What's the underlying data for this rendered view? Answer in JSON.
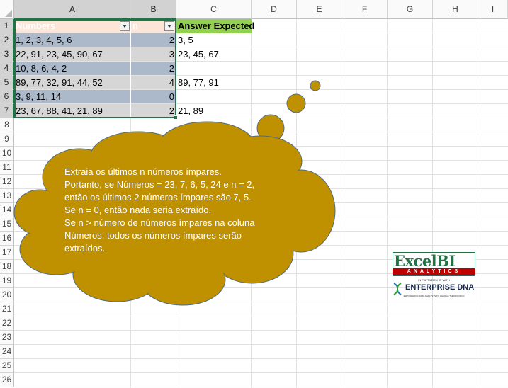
{
  "columns": [
    "A",
    "B",
    "C",
    "D",
    "E",
    "F",
    "G",
    "H",
    "I"
  ],
  "rows": [
    "1",
    "2",
    "3",
    "4",
    "5",
    "6",
    "7",
    "8",
    "9",
    "10",
    "11",
    "12",
    "13",
    "14",
    "15",
    "16",
    "17",
    "18",
    "19",
    "20",
    "21",
    "22",
    "23",
    "24",
    "25",
    "26"
  ],
  "table": {
    "header": {
      "numbers": "Numbers",
      "n": "n"
    },
    "numbers": [
      "1, 2, 3, 4, 5, 6",
      "22, 91, 23, 45, 90, 67",
      "10, 8, 6, 4, 2",
      "89, 77, 32, 91, 44, 52",
      "3, 9, 11, 14",
      "23, 67, 88, 41, 21, 89"
    ],
    "n": [
      "2",
      "3",
      "2",
      "4",
      "0",
      "2"
    ]
  },
  "answer": {
    "header": "Answer Expected",
    "values": [
      "3, 5",
      "23, 45, 67",
      "",
      "89, 77, 91",
      "",
      "21, 89"
    ]
  },
  "callout": {
    "lines": [
      "Extraia os últimos n números ímpares.",
      "Portanto, se Números = 23, 7, 6, 5, 24 e n = 2,",
      "então os últimos 2 números ímpares são 7, 5.",
      "Se n = 0, então nada seria extraído.",
      "Se n > número de números ímpares na coluna",
      "Números, todos os números ímpares serão",
      "extraídos."
    ],
    "fill_color": "#bf9000"
  },
  "logo": {
    "brand": "ExcelBI",
    "sub": "ANALYTICS",
    "partnership": "IN PARTNERSHIP WITH",
    "partner": "ENTERPRISE DNA",
    "tagline": "EMPOWERING DATA ANALYSTS TO CHANGE THEIR WORLD"
  },
  "colors": {
    "table_row_dark": "#acb9ca",
    "table_row_light": "#d6d6d6",
    "header_fill": "#fce4d6",
    "answer_header": "#92d050",
    "selection": "#217346"
  }
}
